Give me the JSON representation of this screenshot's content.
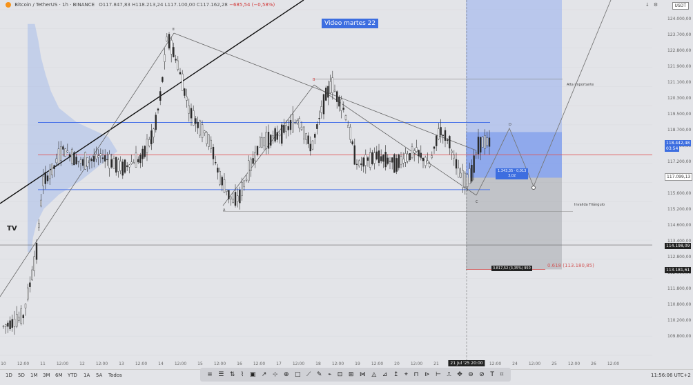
{
  "header": {
    "symbol": "Bitcoin / TetherUS · 1h · BINANCE",
    "ohlc": "O117.847,83 H118.213,24 L117.100,00 C117.162,28",
    "change": "−685,54 (−0,58%)"
  },
  "overlay_title": "Video martes 22",
  "annotations": {
    "label_a": "A",
    "label_b": "B",
    "label_c": "C",
    "label_circle": "②",
    "label_d": "D",
    "alta_importante": "Alta importante",
    "invalida_triangulo": "Invalida Triángulo",
    "measure_line1": "1.343,35 · 0,013",
    "measure_line2": "3,02",
    "fib_box": "3.817,52 (3,35%) 950",
    "fib_label": "0.618 (113.180,85)",
    "tv_logo": "TV"
  },
  "y_axis": {
    "currency": "USDT",
    "ticks": [
      "124.000,00",
      "123.700,00",
      "122.800,00",
      "121.900,00",
      "121.100,00",
      "120.300,00",
      "119.500,00",
      "118.700,00",
      "117.900,00",
      "117.200,00",
      "116.400,00",
      "115.600,00",
      "115.200,00",
      "114.600,00",
      "113.400,00",
      "112.800,00",
      "112.000,00",
      "111.800,00",
      "110.800,00",
      "110.200,00",
      "109.800,00"
    ],
    "badges": {
      "price": "118.442,48",
      "countdown": "03:54",
      "hover": "117.099,13",
      "line": "114.198,09",
      "fib": "113.181,61"
    }
  },
  "x_axis": {
    "ticks": [
      "10",
      "12:00",
      "11",
      "12:00",
      "12",
      "12:00",
      "13",
      "12:00",
      "14",
      "12:00",
      "15",
      "12:00",
      "16",
      "12:00",
      "17",
      "12:00",
      "18",
      "12:00",
      "19",
      "12:00",
      "20",
      "12:00",
      "21",
      "12:00",
      "23",
      "12:00",
      "24",
      "12:00",
      "25",
      "12:00",
      "26",
      "12:00"
    ],
    "cursor_label": "21 Jul '25",
    "cursor_time": "20:00"
  },
  "bottom_bar": {
    "timeframes": [
      "1D",
      "5D",
      "1M",
      "3M",
      "6M",
      "YTD",
      "1A",
      "5A",
      "Todos"
    ],
    "clock": "11:56:06 UTC+2",
    "tools": [
      "≡",
      "☰",
      "⇅",
      "⌇",
      "▣",
      "↗",
      "⊹",
      "⊕",
      "□",
      "⟋",
      "✎",
      "⌁",
      "⊡",
      "⊞",
      "⋈",
      "◬",
      "⊿",
      "↥",
      "⌖",
      "⊓",
      "⊳",
      "⊢",
      "⎍",
      "✥",
      "⊖",
      "⊘",
      "T",
      "⌗"
    ]
  },
  "colors": {
    "background": "#e3e4e8",
    "accent_blue": "#3d6ee0",
    "up": "#f4f5f7",
    "down": "#2b2b2b",
    "support_line": "#4b74e8",
    "mid_line": "#e05050",
    "fib_red": "#d25a5a"
  },
  "chart_data": {
    "type": "candlestick",
    "title": "Bitcoin / TetherUS · 1h · BINANCE",
    "x_range": [
      "Jul 10 2025",
      "Jul 26 2025"
    ],
    "ylim": [
      109400,
      124400
    ],
    "levels": {
      "range_high": 119300,
      "range_mid": 117950,
      "range_low": 116500,
      "invalidation": 115600,
      "alta_importante": 121100,
      "fib_0618": 113180.85,
      "horizontal": 114198.09
    },
    "price_path": [
      {
        "t": "Jul 10 00:00",
        "p": 110800
      },
      {
        "t": "Jul 10 12:00",
        "p": 111200
      },
      {
        "t": "Jul 10 20:00",
        "p": 113800
      },
      {
        "t": "Jul 11 00:00",
        "p": 116800
      },
      {
        "t": "Jul 11 06:00",
        "p": 117300
      },
      {
        "t": "Jul 11 12:00",
        "p": 118200
      },
      {
        "t": "Jul 12 00:00",
        "p": 117600
      },
      {
        "t": "Jul 12 12:00",
        "p": 117900
      },
      {
        "t": "Jul 13 00:00",
        "p": 117400
      },
      {
        "t": "Jul 13 12:00",
        "p": 117800
      },
      {
        "t": "Jul 13 20:00",
        "p": 118900
      },
      {
        "t": "Jul 14 00:00",
        "p": 120500
      },
      {
        "t": "Jul 14 04:00",
        "p": 122900
      },
      {
        "t": "Jul 14 10:00",
        "p": 121800
      },
      {
        "t": "Jul 14 18:00",
        "p": 119700
      },
      {
        "t": "Jul 15 06:00",
        "p": 118500
      },
      {
        "t": "Jul 15 12:00",
        "p": 117000
      },
      {
        "t": "Jul 15 20:00",
        "p": 116000
      },
      {
        "t": "Jul 16 00:00",
        "p": 116200
      },
      {
        "t": "Jul 16 12:00",
        "p": 118400
      },
      {
        "t": "Jul 17 00:00",
        "p": 118800
      },
      {
        "t": "Jul 17 12:00",
        "p": 119400
      },
      {
        "t": "Jul 17 20:00",
        "p": 118200
      },
      {
        "t": "Jul 18 04:00",
        "p": 120300
      },
      {
        "t": "Jul 18 08:00",
        "p": 120900
      },
      {
        "t": "Jul 18 16:00",
        "p": 119800
      },
      {
        "t": "Jul 19 00:00",
        "p": 117500
      },
      {
        "t": "Jul 19 12:00",
        "p": 117900
      },
      {
        "t": "Jul 20 00:00",
        "p": 117600
      },
      {
        "t": "Jul 20 12:00",
        "p": 118100
      },
      {
        "t": "Jul 20 20:00",
        "p": 117500
      },
      {
        "t": "Jul 21 02:00",
        "p": 119000
      },
      {
        "t": "Jul 21 08:00",
        "p": 118500
      },
      {
        "t": "Jul 21 14:00",
        "p": 117100
      },
      {
        "t": "Jul 21 18:00",
        "p": 116800
      },
      {
        "t": "Jul 21 22:00",
        "p": 117300
      },
      {
        "t": "Jul 22 02:00",
        "p": 118442.48
      }
    ],
    "volume_profile": [
      {
        "p": 123400,
        "v": 0.08
      },
      {
        "p": 122700,
        "v": 0.12
      },
      {
        "p": 122000,
        "v": 0.15
      },
      {
        "p": 121300,
        "v": 0.2
      },
      {
        "p": 120600,
        "v": 0.26
      },
      {
        "p": 119900,
        "v": 0.35
      },
      {
        "p": 119300,
        "v": 0.55
      },
      {
        "p": 118700,
        "v": 0.9
      },
      {
        "p": 118100,
        "v": 1.0
      },
      {
        "p": 117500,
        "v": 0.8
      },
      {
        "p": 116900,
        "v": 0.6
      },
      {
        "p": 116300,
        "v": 0.35
      },
      {
        "p": 115700,
        "v": 0.18
      },
      {
        "p": 115100,
        "v": 0.1
      },
      {
        "p": 114500,
        "v": 0.06
      },
      {
        "p": 113900,
        "v": 0.04
      }
    ]
  }
}
